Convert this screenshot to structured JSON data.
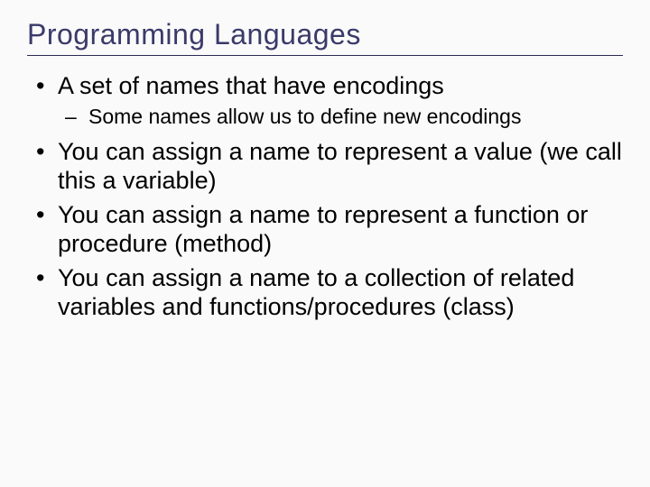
{
  "title": "Programming Languages",
  "bullets": [
    {
      "text": "A set of names that have encodings",
      "sub": [
        "Some names allow us to define new encodings"
      ]
    },
    {
      "text": "You can assign a name to represent a value (we call this a variable)"
    },
    {
      "text": "You can assign a name to represent a function or procedure (method)"
    },
    {
      "text": "You can assign a name to a collection of related variables and functions/procedures (class)"
    }
  ]
}
